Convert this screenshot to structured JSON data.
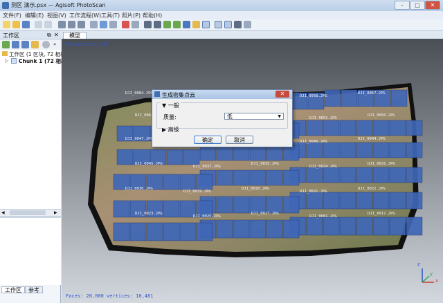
{
  "window": {
    "title": "测区 演示.psx — Agisoft PhotoScan",
    "minimize": "–",
    "maximize": "□",
    "close": "✕"
  },
  "menu": [
    "文件(F)",
    "编辑(E)",
    "视图(V)",
    "工作流程(W)",
    "工具(T)",
    "照片(P)",
    "帮助(H)"
  ],
  "workspace": {
    "title": "工作区",
    "tree_root": "工作区 (1 区块, 72 相机",
    "chunk": "Chunk 1 (72 相机",
    "tabs": [
      "工作区",
      "参考"
    ]
  },
  "viewport": {
    "tab": "模型",
    "perspective": "Perspective 30°",
    "status": "Faces: 20,000 vertices: 10,481",
    "axes": {
      "x": "x",
      "y": "y",
      "z": "z"
    },
    "camera_labels": [
      "DJI_0084.JPG",
      "DJI_0087.JPG",
      "DJI_0079.JPG",
      "DJI_0068.JPG",
      "DJI_0067.JPG",
      "DJI_0061.JPG",
      "DJI_0055.JPG",
      "DJI_0064.JPG",
      "DJI_0051.JPG",
      "DJI_0050.JPG",
      "DJI_0047.JPG",
      "DJI_0036.JPG",
      "DJI_0039.JPG",
      "DJI_0040.JPG",
      "DJI_0044.JPG",
      "DJI_0045.JPG",
      "DJI_0037.JPG",
      "DJI_0035.JPG",
      "DJI_0034.JPG",
      "DJI_0031.JPG",
      "DJI_0030.JPG",
      "DJI_0019.JPG",
      "DJI_0020.JPG",
      "DJI_0021.JPG",
      "DJI_0022.JPG",
      "DJI_0023.JPG",
      "DJI_0025.JPG",
      "DJI_0027.JPG",
      "DJI_0001.JPG",
      "DJI_0017.JPG"
    ]
  },
  "dialog": {
    "title": "生成密集点云",
    "close": "✕",
    "section_general": "一般",
    "quality_label": "质量:",
    "quality_value": "低",
    "section_advanced": "高级",
    "ok": "确定",
    "cancel": "取消"
  },
  "colors": {
    "camera_blue": "#3f67b6",
    "titlebar": "#b9cde6",
    "close_red": "#c94a3a"
  }
}
